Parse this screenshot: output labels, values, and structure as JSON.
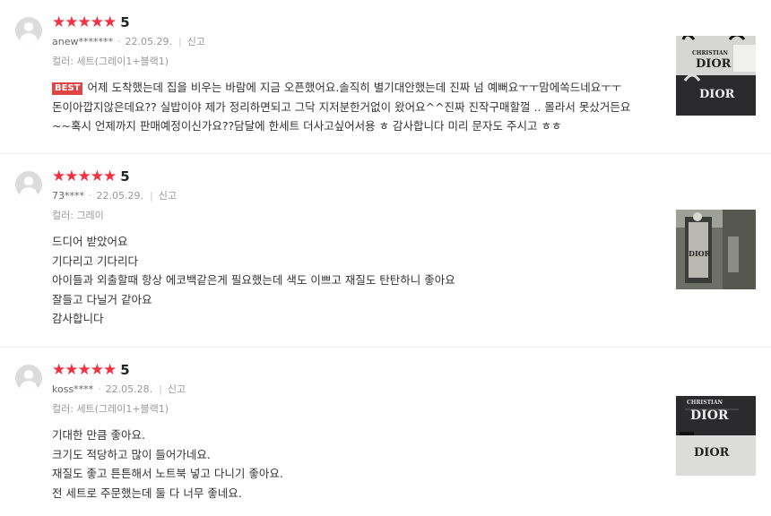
{
  "reviews": [
    {
      "stars": "★★★★★",
      "score": "5",
      "user": "anew*******",
      "date": "22.05.29.",
      "report": "신고",
      "option": "컬러: 세트(그레이1+블랙1)",
      "badge": "BEST",
      "lines": [
        "어제 도착했는데 집을 비우는 바람에 지금 오픈했어요.솔직히 별기대안했는데 진짜 넘 예뻐요ㅜㅜ맘에쏙드네요ㅜㅜ",
        "돈이아깝지않은데요?? 실밥이야 제가 정리하면되고 그닥 지저분한거없이 왔어요^^진짜 진작구매할껄 .. 몰라서 못샀거든요",
        "~~혹시 언제까지 판매예정이신가요??담달에 한세트 더사고싶어서용 ㅎ 감사합니다 미리 문자도 주시고 ㅎㅎ"
      ],
      "photo_text": [
        "CHRISTIAN",
        "DIOR",
        "DIOR"
      ]
    },
    {
      "stars": "★★★★★",
      "score": "5",
      "user": "73****",
      "date": "22.05.29.",
      "report": "신고",
      "option": "컬러: 그레이",
      "lines": [
        "드디어 받았어요",
        "기다리고 기다리다",
        "아이들과 외출할때 항상 에코백같은게 필요했는데 색도 이쁘고 재질도 탄탄하니 좋아요",
        "잘들고 다닐거 같아요",
        "감사합니다"
      ],
      "photo_text": [
        "DIOR"
      ]
    },
    {
      "stars": "★★★★★",
      "score": "5",
      "user": "koss****",
      "date": "22.05.28.",
      "report": "신고",
      "option": "컬러: 세트(그레이1+블랙1)",
      "lines": [
        "기대한 만큼 좋아요.",
        "크기도 적당하고 많이 들어가네요.",
        "재질도 좋고 튼튼해서 노트북 넣고 다니기 좋아요.",
        "전 세트로 주문했는데 둘 다 너무 좋네요."
      ],
      "photo_text": [
        "CHRISTIAN",
        "DIOR",
        "DIOR"
      ]
    }
  ],
  "colors": {
    "star": "#f43142",
    "best_badge": "#e04545",
    "meta": "#999999"
  }
}
